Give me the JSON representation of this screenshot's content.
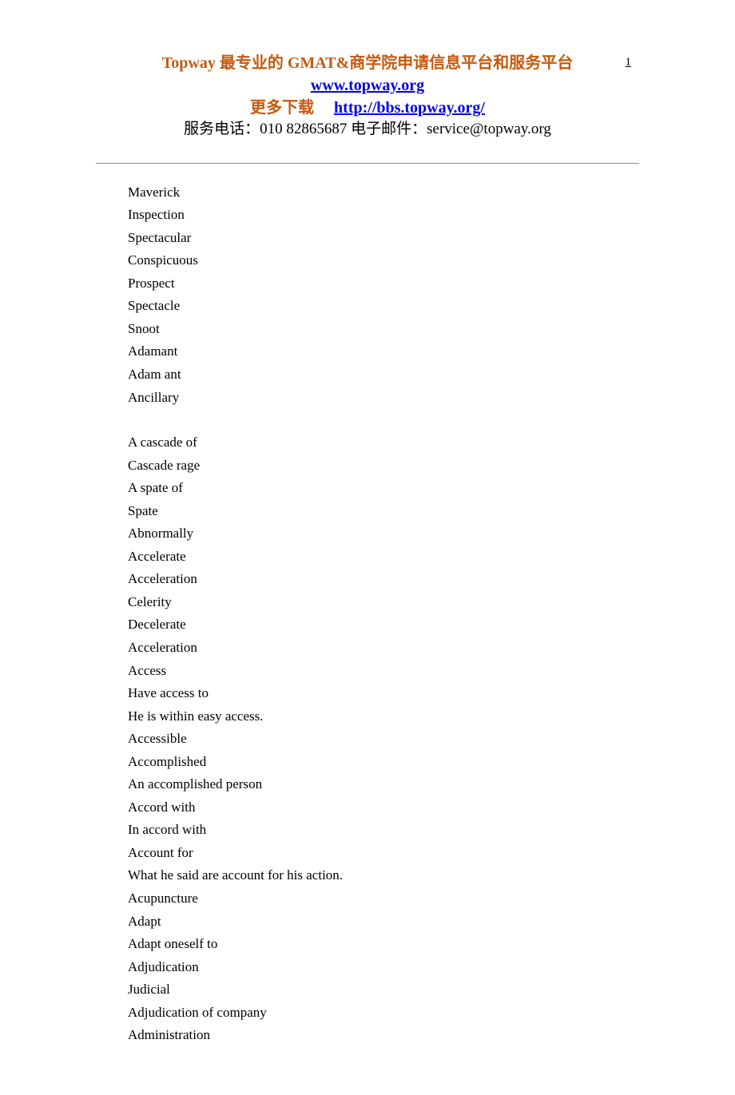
{
  "header": {
    "title": "Topway  最专业的 GMAT&商学院申请信息平台和服务平台",
    "link1": "www.topway.org",
    "download_label": "更多下载",
    "link2": "http://bbs.topway.org/",
    "contact": "服务电话：010 82865687  电子邮件：service@topway.org"
  },
  "page_number": "1",
  "words_group1": [
    "Maverick",
    "Inspection",
    "Spectacular",
    "Conspicuous",
    "Prospect",
    "Spectacle",
    "Snoot",
    "Adamant",
    "Adam ant",
    "Ancillary"
  ],
  "words_group2": [
    "A cascade of",
    "Cascade rage",
    "A spate of",
    "Spate",
    "Abnormally",
    "Accelerate",
    "Acceleration",
    "Celerity",
    "Decelerate",
    "Acceleration",
    "Access",
    "Have access to",
    "He is within easy access.",
    "Accessible",
    "Accomplished",
    "An accomplished person",
    "Accord with",
    "In accord with",
    "Account for",
    "What he said are account for his action.",
    "Acupuncture",
    "Adapt",
    "Adapt oneself to",
    "Adjudication",
    "Judicial",
    "Adjudication of company",
    "Administration"
  ]
}
